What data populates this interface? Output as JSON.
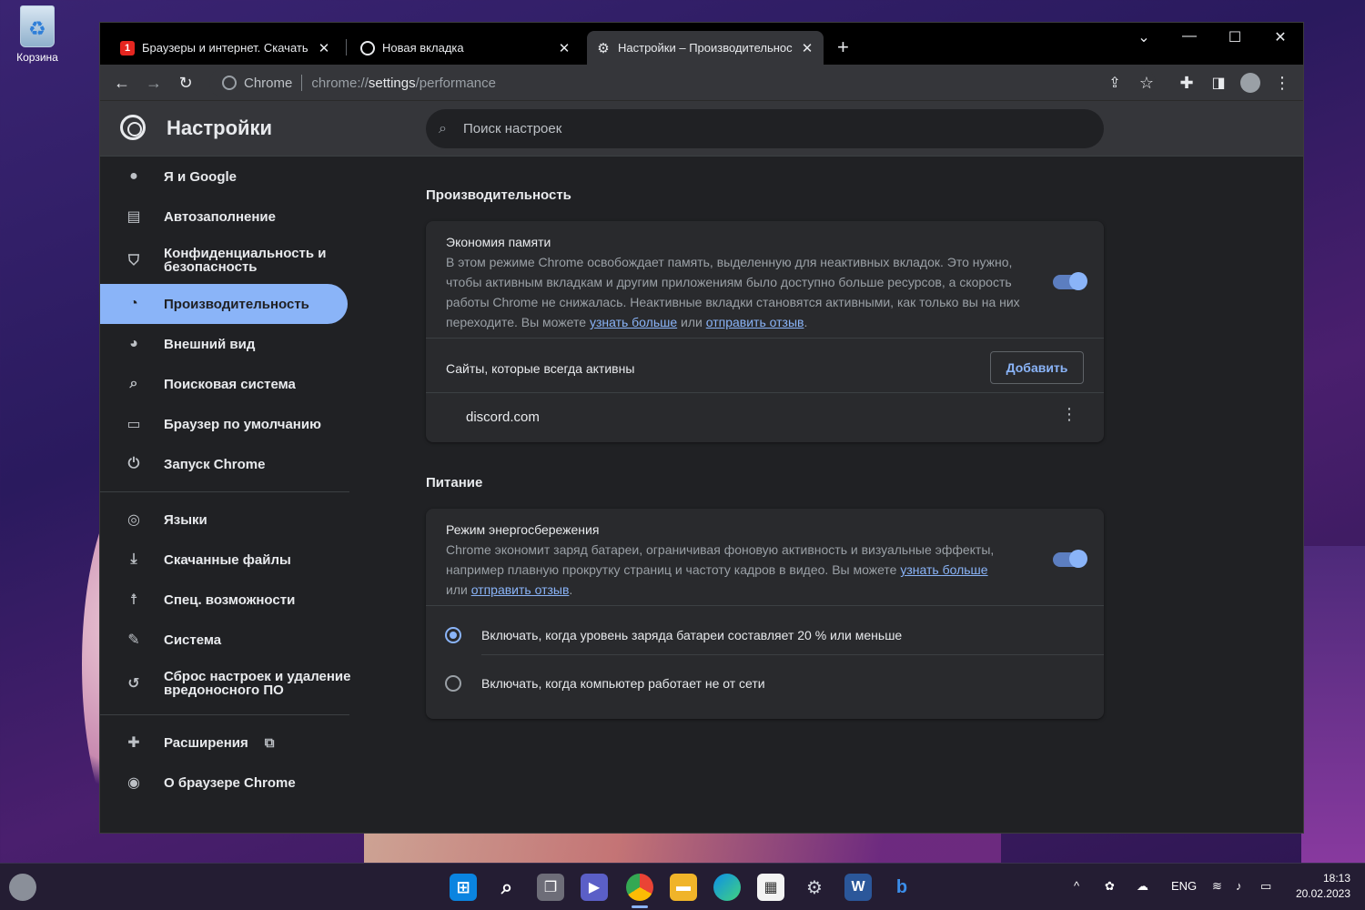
{
  "desktop": {
    "recycle_bin_label": "Корзина"
  },
  "tabs": [
    {
      "title": "Браузеры и интернет. Скачать б",
      "favicon_text": "1",
      "favicon_color": "#e52620"
    },
    {
      "title": "Новая вкладка",
      "favicon_text": "",
      "favicon_color": "#5f6368"
    },
    {
      "title": "Настройки – Производительнос",
      "favicon_text": "⚙",
      "favicon_color": "#000000"
    }
  ],
  "toolbar": {
    "chip": "Chrome",
    "url_scheme": "chrome://",
    "url_host": "settings",
    "url_path": "/performance"
  },
  "settings": {
    "title": "Настройки",
    "search_placeholder": "Поиск настроек"
  },
  "sidebar": {
    "items": [
      {
        "label": "Я и Google",
        "icon": "person-icon"
      },
      {
        "label": "Автозаполнение",
        "icon": "clipboard-icon"
      },
      {
        "label": "Конфиденциальность и безопасность",
        "icon": "shield-icon"
      },
      {
        "label": "Производительность",
        "icon": "speedometer-icon"
      },
      {
        "label": "Внешний вид",
        "icon": "palette-icon"
      },
      {
        "label": "Поисковая система",
        "icon": "search-icon"
      },
      {
        "label": "Браузер по умолчанию",
        "icon": "browser-icon"
      },
      {
        "label": "Запуск Chrome",
        "icon": "power-icon"
      },
      {
        "label": "Языки",
        "icon": "globe-icon"
      },
      {
        "label": "Скачанные файлы",
        "icon": "download-icon"
      },
      {
        "label": "Спец. возможности",
        "icon": "accessibility-icon"
      },
      {
        "label": "Система",
        "icon": "wrench-icon"
      },
      {
        "label": "Сброс настроек и удаление вредоносного ПО",
        "icon": "reset-icon"
      },
      {
        "label": "Расширения",
        "icon": "puzzle-icon"
      },
      {
        "label": "О браузере Chrome",
        "icon": "chrome-icon"
      }
    ]
  },
  "performance": {
    "section_title": "Производительность",
    "memory_saver": {
      "label": "Экономия памяти",
      "desc": "В этом режиме Chrome освобождает память, выделенную для неактивных вкладок. Это нужно, чтобы активным вкладкам и другим приложениям было доступно больше ресурсов, а скорость работы Chrome не снижалась. Неактивные вкладки становятся активными, как только вы на них переходите. Вы можете ",
      "link_more": "узнать больше",
      "or": " или ",
      "link_feedback": "отправить отзыв",
      "end": ".",
      "enabled": true
    },
    "always_active": {
      "label": "Сайты, которые всегда активны",
      "add_button": "Добавить",
      "sites": [
        "discord.com"
      ]
    }
  },
  "power": {
    "section_title": "Питание",
    "energy_saver": {
      "label": "Режим энергосбережения",
      "desc": "Chrome экономит заряд батареи, ограничивая фоновую активность и визуальные эффекты, например плавную прокрутку страниц и частоту кадров в видео. Вы можете ",
      "link_more": "узнать больше",
      "or": "или ",
      "link_feedback": "отправить отзыв",
      "end": ".",
      "enabled": true
    },
    "options": [
      {
        "label": "Включать, когда уровень заряда батареи составляет 20 % или меньше",
        "selected": true
      },
      {
        "label": "Включать, когда компьютер работает не от сети",
        "selected": false
      }
    ]
  },
  "taskbar": {
    "lang": "ENG",
    "time": "18:13",
    "date": "20.02.2023"
  },
  "colors": {
    "accent": "#8ab4f8",
    "bg": "#202124",
    "card": "#292a2d"
  }
}
